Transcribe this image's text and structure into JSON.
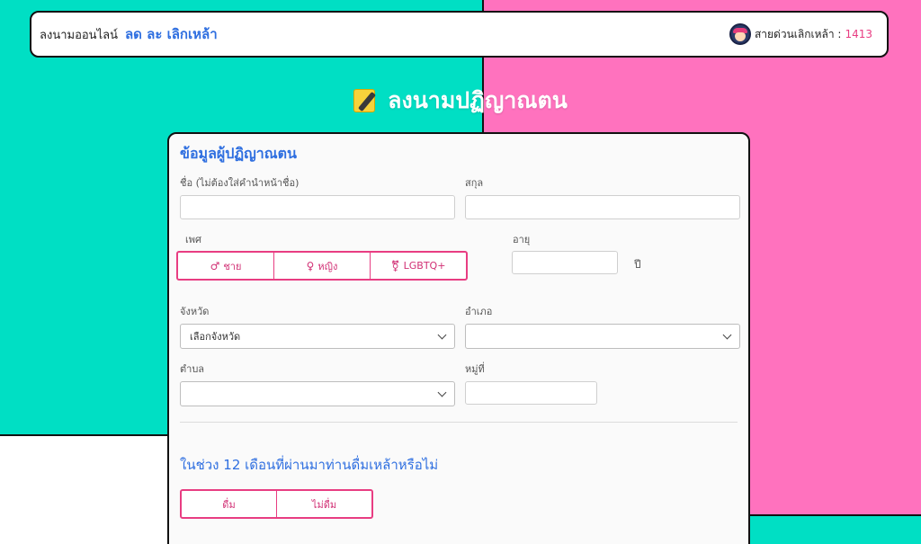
{
  "header": {
    "brand_main": "ลงนามออนไลน์",
    "brand_accent": "ลด ละ เลิกเหล้า",
    "hotline_label": "สายด่วนเลิกเหล้า :",
    "hotline_number": "1413"
  },
  "page": {
    "title": "ลงนามปฏิญาณตน",
    "title_icon": "memo-icon"
  },
  "form": {
    "section_title": "ข้อมูลผู้ปฏิญาณตน",
    "first_name_label": "ชื่อ (ไม่ต้องใส่คำนำหน้าชื่อ)",
    "first_name_value": "",
    "last_name_label": "สกุล",
    "last_name_value": "",
    "gender_label": "เพศ",
    "gender_options": [
      {
        "symbol": "♂",
        "label": "ชาย"
      },
      {
        "symbol": "♀",
        "label": "หญิง"
      },
      {
        "symbol": "⚧",
        "label": "LGBTQ+"
      }
    ],
    "age_label": "อายุ",
    "age_value": "",
    "age_unit": "ปี",
    "province_label": "จังหวัด",
    "province_value": "เลือกจังหวัด",
    "district_label": "อำเภอ",
    "district_value": "",
    "subdistrict_label": "ตำบล",
    "subdistrict_value": "",
    "village_label": "หมู่ที่",
    "village_value": ""
  },
  "question": {
    "title": "ในช่วง 12 เดือนที่ผ่านมาท่านดื่มเหล้าหรือไม่",
    "options": [
      "ดื่ม",
      "ไม่ดื่ม"
    ]
  },
  "colors": {
    "teal": "#00dfc4",
    "pink": "#ff72be",
    "accent_blue": "#2f6fe0",
    "accent_pink": "#e83d82"
  }
}
